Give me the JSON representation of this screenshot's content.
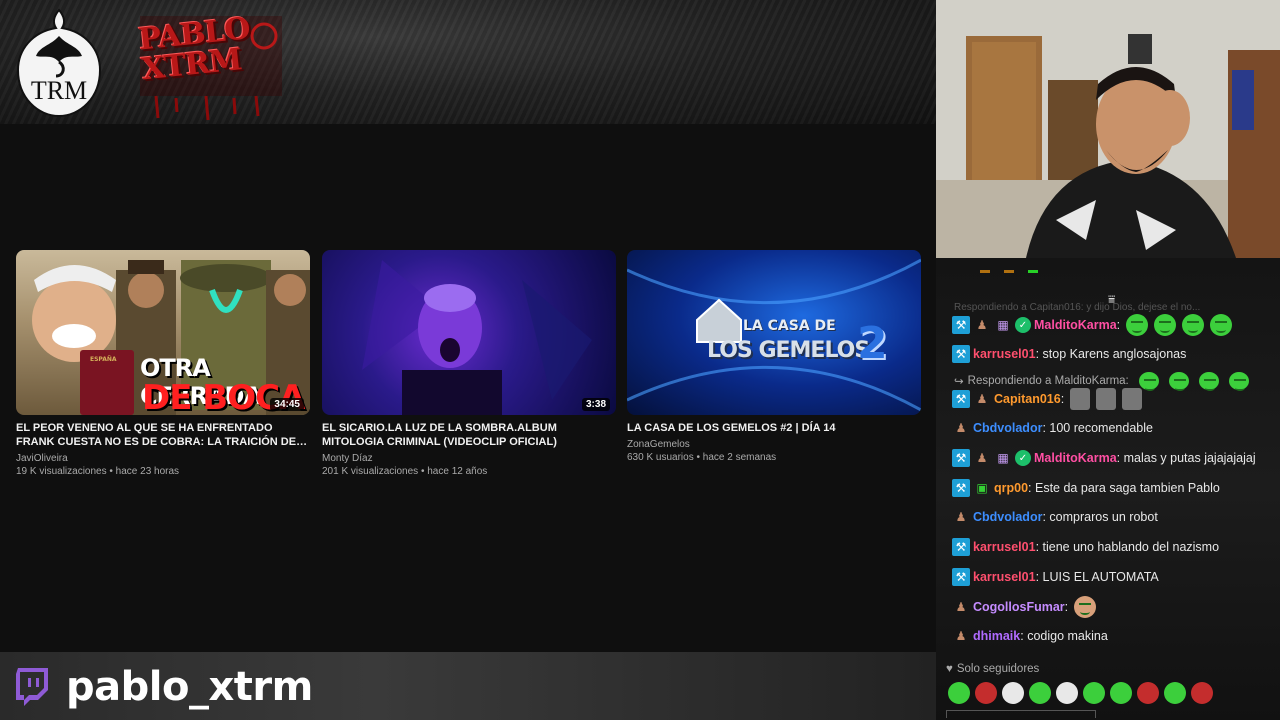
{
  "banner": {
    "trm_logo_text": "TRM",
    "pablo_logo_text": "PABLO XTRM"
  },
  "videos": [
    {
      "title": "EL PEOR VENENO AL QUE SE HA ENFRENTADO FRANK CUESTA NO ES DE COBRA: LA TRAICIÓN DE UN AMIGO...",
      "channel": "JaviOliveira",
      "meta": "19 K visualizaciones • hace 23 horas",
      "duration": "34:45",
      "thumb_text_1": "OTRA CERRADA",
      "thumb_text_2": "DE BOCA",
      "passport_text": "ESPAÑA"
    },
    {
      "title": "EL SICARIO.LA LUZ DE LA SOMBRA.ALBUM MITOLOGIA CRIMINAL (VIDEOCLIP OFICIAL)",
      "channel": "Monty Díaz",
      "meta": "201 K visualizaciones • hace 12 años",
      "duration": "3:38"
    },
    {
      "title": "LA CASA DE LOS GEMELOS #2 | DÍA 14",
      "channel": "ZonaGemelos",
      "meta": "630 K usuarios • hace 2 semanas",
      "thumb_text_1": "LA CASA DE",
      "thumb_text_2": "LOS GEMELOS",
      "thumb_number": "2"
    }
  ],
  "bottom_bar": {
    "channel_name": "pablo_xtrm",
    "icon": "twitch-icon"
  },
  "chat": {
    "faded_reply": "Respondiendo a Capitan016: y dijo Dios, dejese el no...",
    "messages": [
      {
        "user": "MalditoKarma",
        "color": "#ff4fa3",
        "text": "",
        "badges": [
          "mod",
          "sub",
          "gift",
          "verified"
        ],
        "emotes": 4
      },
      {
        "user": "karrusel01",
        "color": "#ff4f6e",
        "text": "stop Karens anglosajonas",
        "badges": [
          "mod"
        ]
      },
      {
        "reply_to": "Respondiendo a MalditoKarma:",
        "reply_emotes": 4
      },
      {
        "user": "Capitan016",
        "color": "#ff9a2e",
        "text": "",
        "badges": [
          "mod",
          "sub"
        ],
        "gray_emotes": 3
      },
      {
        "user": "Cbdvolador",
        "color": "#3d8eff",
        "text": "100 recomendable",
        "badges": [
          "sub"
        ]
      },
      {
        "user": "MalditoKarma",
        "color": "#ff4fa3",
        "text": "malas y putas jajajajajaj",
        "badges": [
          "mod",
          "sub",
          "gift",
          "verified"
        ]
      },
      {
        "user": "qrp00",
        "color": "#ff9a2e",
        "text": "Este da para saga tambien Pablo",
        "badges": [
          "mod",
          "bolt"
        ]
      },
      {
        "user": "Cbdvolador",
        "color": "#3d8eff",
        "text": "compraros un robot",
        "badges": [
          "sub"
        ]
      },
      {
        "user": "karrusel01",
        "color": "#ff4f6e",
        "text": "tiene uno hablando del nazismo",
        "badges": [
          "mod"
        ]
      },
      {
        "user": "karrusel01",
        "color": "#ff4f6e",
        "text": "LUIS EL AUTOMATA",
        "badges": [
          "mod"
        ]
      },
      {
        "user": "CogollosFumar",
        "color": "#c58cff",
        "text": "",
        "badges": [
          "sub"
        ],
        "face_emote": true
      },
      {
        "user": "dhimaik",
        "color": "#b06bff",
        "text": "codigo makina",
        "badges": [
          "sub"
        ]
      }
    ],
    "followers_only": "Solo seguidores"
  },
  "colors": {
    "mod_badge": "#1e9fd6",
    "emote_green": "#3ccf3c",
    "background": "#0f0f0f"
  }
}
